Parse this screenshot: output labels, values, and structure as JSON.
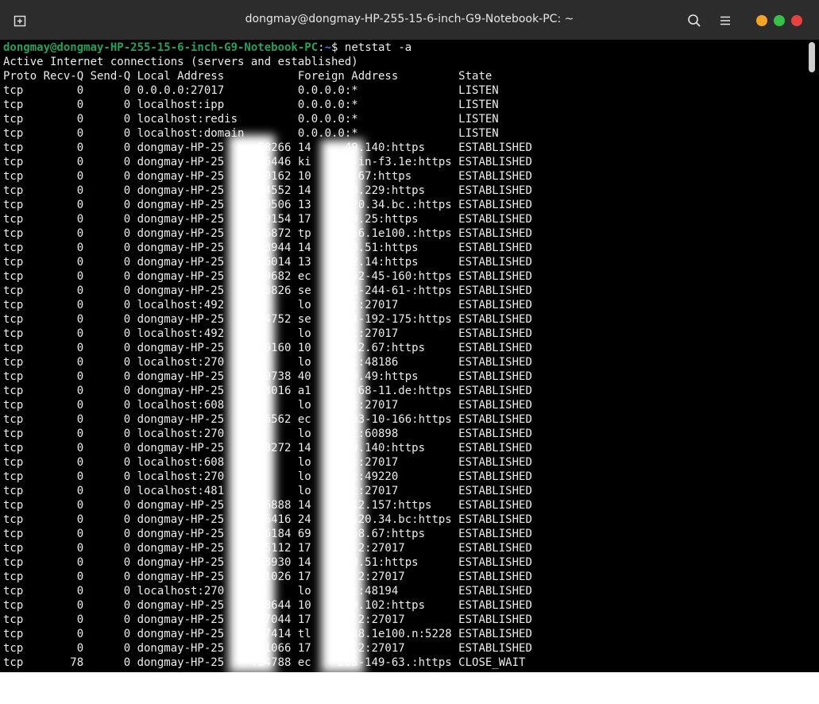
{
  "window": {
    "title": "dongmay@dongmay-HP-255-15-6-inch-G9-Notebook-PC: ~",
    "icons": [
      "new-tab-icon",
      "search-icon",
      "hamburger-menu-icon",
      "minimize-icon",
      "maximize-icon",
      "close-icon"
    ],
    "colors": {
      "titlebar": "#2c2c2c",
      "terminal_bg": "#000000",
      "prompt_user": "#27a05a",
      "prompt_path": "#3f7fd8",
      "minimize": "#f4a326",
      "maximize": "#36c147",
      "close": "#e9413f"
    }
  },
  "terminal": {
    "prompt": {
      "user_host": "dongmay@dongmay-HP-255-15-6-inch-G9-Notebook-PC",
      "separator": ":",
      "path": "~",
      "symbol": "$",
      "command": "netstat -a"
    },
    "header": "Active Internet connections (servers and established)",
    "column_header": "Proto Recv-Q Send-Q Local Address           Foreign Address         State",
    "rows": [
      "tcp        0      0 0.0.0.0:27017           0.0.0.0:*               LISTEN",
      "tcp        0      0 localhost:ipp           0.0.0.0:*               LISTEN",
      "tcp        0      0 localhost:redis         0.0.0.0:*               LISTEN",
      "tcp        0      0 localhost:domain        0.0.0.0:*               LISTEN",
      "tcp        0      0 dongmay-HP-25    :58266 14    .49.140:https     ESTABLISHED",
      "tcp        0      0 dongmay-HP-25    :46446 ki    07-in-f3.1e:https ESTABLISHED",
      "tcp        0      0 dongmay-HP-25    :49162 10    .6.67:https       ESTABLISHED",
      "tcp        0      0 dongmay-HP-25    :34552 14    .49.229:https     ESTABLISHED",
      "tcp        0      0 dongmay-HP-25    :40506 13    .120.34.bc.:https ESTABLISHED",
      "tcp        0      0 dongmay-HP-25    :59154 17    .69.25:https      ESTABLISHED",
      "tcp        0      0 dongmay-HP-25    :46872 tp    f156.1e100.:https ESTABLISHED",
      "tcp        0      0 dongmay-HP-25    :53944 14    .49.51:https      ESTABLISHED",
      "tcp        0      0 dongmay-HP-25    :56014 13    .42.14:https      ESTABLISHED",
      "tcp        0      0 dongmay-HP-25    :59682 ec    -202-45-160:https ESTABLISHED",
      "tcp        0      0 dongmay-HP-25    :43826 se    -18-244-61-:https ESTABLISHED",
      "tcp        0      0 localhost:492           lo    ost:27017         ESTABLISHED",
      "tcp        0      0 dongmay-HP-25    :34752 se    -54-192-175:https ESTABLISHED",
      "tcp        0      0 localhost:492           lo    ost:27017         ESTABLISHED",
      "tcp        0      0 dongmay-HP-25    :60160 10    4.42.67:https     ESTABLISHED",
      "tcp        0      0 localhost:270           lo    ost:48186         ESTABLISHED",
      "tcp        0      0 dongmay-HP-25    :39738 40    219.49:https      ESTABLISHED",
      "tcp        0      0 dongmay-HP-25    :33016 a1    03-68-11.de:https ESTABLISHED",
      "tcp        0      0 localhost:608           lo    ost:27017         ESTABLISHED",
      "tcp        0      0 dongmay-HP-25    :46562 ec    -203-10-166:https ESTABLISHED",
      "tcp        0      0 localhost:270           lo    ost:60898         ESTABLISHED",
      "tcp        0      0 dongmay-HP-25    :58272 14    .49.140:https     ESTABLISHED",
      "tcp        0      0 localhost:608           lo    ost:27017         ESTABLISHED",
      "tcp        0      0 localhost:270           lo    ost:49220         ESTABLISHED",
      "tcp        0      0 localhost:481           lo    ost:27017         ESTABLISHED",
      "tcp        0      0 dongmay-HP-25    :46888 14    .112.157:https    ESTABLISHED",
      "tcp        0      0 dongmay-HP-25    :46416 24    5.120.34.bc:https ESTABLISHED",
      "tcp        0      0 dongmay-HP-25    :46184 69    .158.67:https     ESTABLISHED",
      "tcp        0      0 dongmay-HP-25    :35112 17    .0.2:27017        ESTABLISHED",
      "tcp        0      0 dongmay-HP-25    :53930 14    .49.51:https      ESTABLISHED",
      "tcp        0      0 dongmay-HP-25    :41026 17    .0.2:27017        ESTABLISHED",
      "tcp        0      0 localhost:270           lo    ost:48194         ESTABLISHED",
      "tcp        0      0 dongmay-HP-25    :48644 10    .39.102:https     ESTABLISHED",
      "tcp        0      0 dongmay-HP-25    :47044 17    .0.2:27017        ESTABLISHED",
      "tcp        0      0 dongmay-HP-25    :47414 tl    f188.1e100.n:5228 ESTABLISHED",
      "tcp        0      0 dongmay-HP-25    :41066 17    .0.2:27017        ESTABLISHED",
      "tcp       78      0 dongmay-HP-25    :34788 ec    235-149-63.:https CLOSE_WAIT"
    ]
  }
}
